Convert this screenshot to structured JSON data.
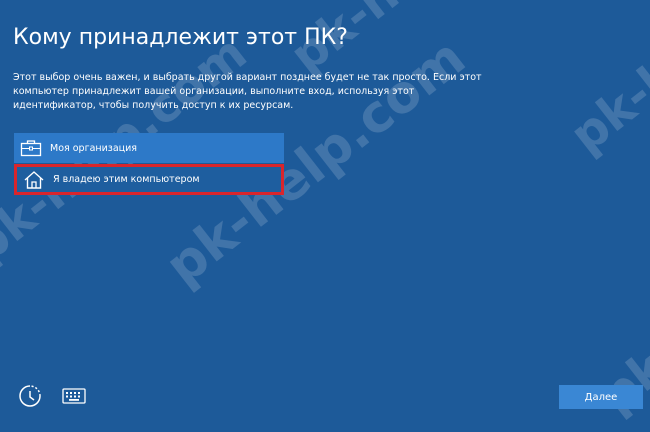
{
  "page": {
    "title": "Кому принадлежит этот ПК?",
    "description": "Этот выбор очень важен, и выбрать другой вариант позднее будет не так просто. Если этот компьютер принадлежит вашей организации, выполните вход, используя этот идентификатор, чтобы получить доступ к их ресурсам."
  },
  "options": [
    {
      "label": "Моя организация",
      "icon": "briefcase-icon"
    },
    {
      "label": "Я владею этим компьютером",
      "icon": "home-icon",
      "highlighted": true
    }
  ],
  "footer": {
    "accessibility_icon": "accessibility-icon",
    "keyboard_icon": "keyboard-icon",
    "next_label": "Далее"
  },
  "watermark": {
    "text": "pk-help.com"
  },
  "colors": {
    "background": "#1d5a99",
    "option_selected": "#2d79c8",
    "highlight_border": "#d9252c",
    "button": "#3a87d4"
  }
}
